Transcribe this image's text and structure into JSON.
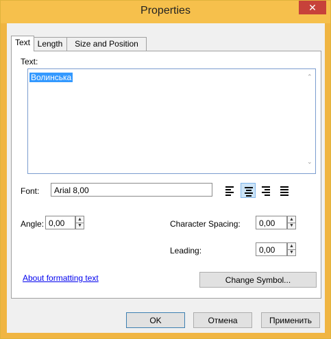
{
  "window": {
    "title": "Properties",
    "close_glyph": "✕"
  },
  "tabs": [
    "Text",
    "Length",
    "Size and Position"
  ],
  "text_section": {
    "label": "Text:",
    "value": "Волинська"
  },
  "font": {
    "label": "Font:",
    "value": "Arial 8,00"
  },
  "angle": {
    "label": "Angle:",
    "value": "0,00"
  },
  "character_spacing": {
    "label": "Character Spacing:",
    "value": "0,00"
  },
  "leading": {
    "label": "Leading:",
    "value": "0,00"
  },
  "alignment": {
    "options": [
      "left",
      "center",
      "right",
      "justify"
    ],
    "selected": "center"
  },
  "about_link": "About formatting text",
  "change_symbol": "Change Symbol...",
  "footer": {
    "ok": "OK",
    "cancel": "Отмена",
    "apply": "Применить"
  },
  "colors": {
    "title_bar": "#f6c04c",
    "close": "#c7423a",
    "selection": "#3399ff",
    "link": "#0000ee"
  }
}
